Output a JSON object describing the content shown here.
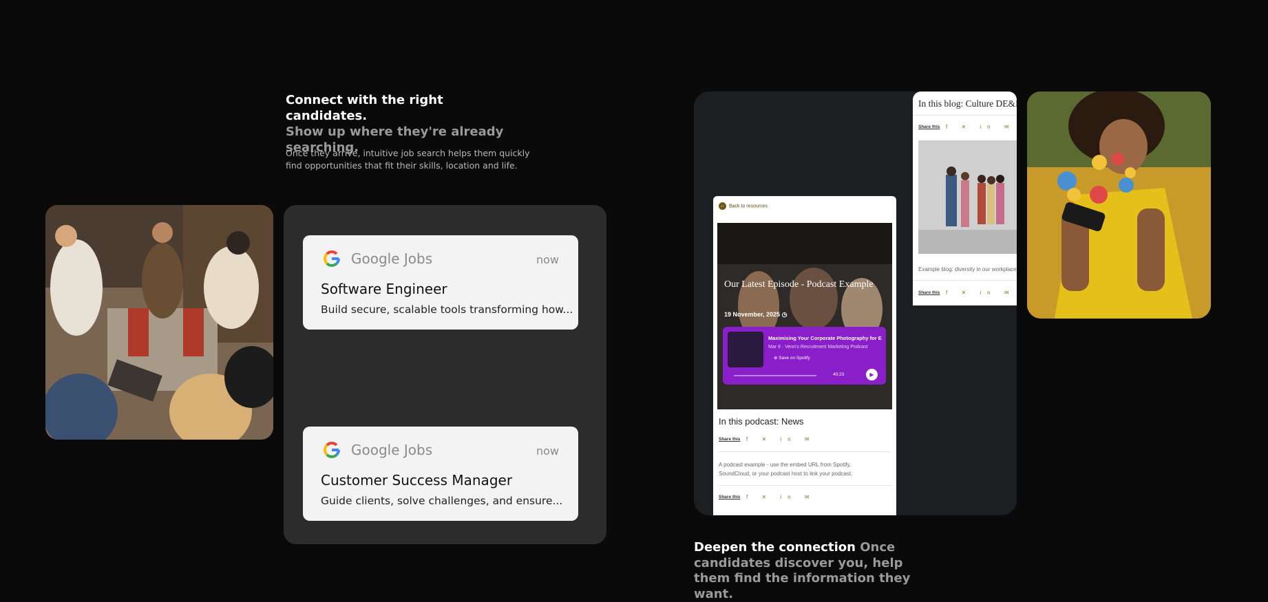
{
  "left_section": {
    "headline_strong": "Connect with the right candidates.",
    "headline_muted": "Show up where they're already searching.",
    "body": "Once they arrive, intuitive job search helps them quickly find opportunities that fit their skills, location and life."
  },
  "notifications": [
    {
      "source": "Google Jobs",
      "time": "now",
      "title": "Software Engineer",
      "description": "Build secure, scalable tools transforming how..."
    },
    {
      "source": "Google Jobs",
      "time": "now",
      "title": "Customer Success Manager",
      "description": "Guide clients, solve challenges, and ensure..."
    }
  ],
  "blog_card": {
    "title": "In this blog: Culture DE&I",
    "share_label": "Share this",
    "share_icons": [
      "facebook-icon",
      "x-icon",
      "linkedin-icon",
      "mail-icon"
    ],
    "caption": "Example blog: diversity in our workplace"
  },
  "podcast_card": {
    "back_link": "Back to resources",
    "hero_title": "Our Latest Episode - Podcast Example",
    "hero_date": "19 November, 2025",
    "spotify": {
      "episode_title": "Maximising Your Corporate Photography for E",
      "episode_meta": "Mar 9 · Venn's Recruitment Marketing Podcast",
      "save_label": "Save on Spotify",
      "duration": "40:23"
    },
    "title": "In this podcast: News",
    "share_label": "Share this",
    "description": "A podcast example - use the embed URL from Spotify, SoundCloud, or your podcast host to link your podcast."
  },
  "right_section": {
    "headline_strong": "Deepen the connection",
    "headline_muted": "Once candidates discover you, help them find the information they want."
  },
  "colors": {
    "background": "#0a0a0a",
    "card_dark": "#2c2c2c",
    "spotify_purple": "#8a1fc9",
    "accent_olive": "#6b5a1a"
  }
}
